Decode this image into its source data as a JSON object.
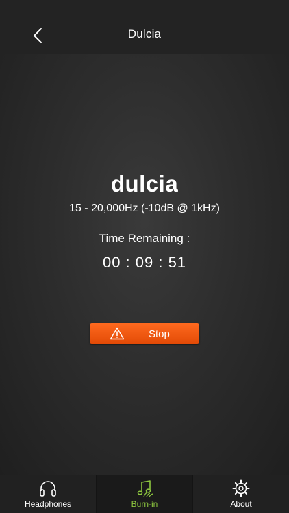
{
  "header": {
    "title": "Dulcia",
    "back_icon": "chevron-left-icon"
  },
  "main": {
    "brand": "dulcia",
    "spec": "15 - 20,000Hz (-10dB @ 1kHz)",
    "time_label": "Time Remaining :",
    "time_value": "00 : 09 : 51",
    "stop_button": {
      "label": "Stop",
      "icon": "warning-icon",
      "color": "#f05a12"
    }
  },
  "tabbar": {
    "active_color": "#8dc63f",
    "tabs": [
      {
        "label": "Headphones",
        "icon": "headphones-icon",
        "active": false
      },
      {
        "label": "Burn-in",
        "icon": "music-note-icon",
        "active": true
      },
      {
        "label": "About",
        "icon": "gear-icon",
        "active": false
      }
    ]
  }
}
